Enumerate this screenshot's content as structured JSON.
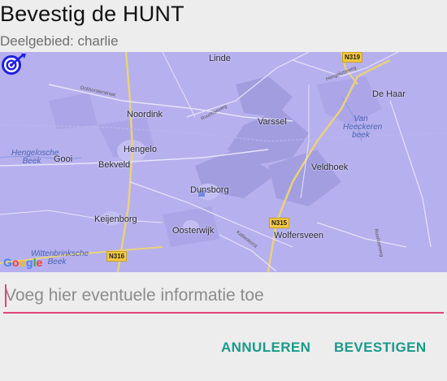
{
  "dialog": {
    "title": "Bevestig de HUNT",
    "subtitle": "Deelgebied: charlie"
  },
  "map": {
    "places": [
      "Linde",
      "De Haar",
      "Noordink",
      "Varssel",
      "Van Heeckeren beek",
      "Hengelo",
      "Hengelosche Beek",
      "Gooi",
      "Bekveld",
      "Veldhoek",
      "Dunsborg",
      "Keijenborg",
      "Oosterwijk",
      "Wolfersveen",
      "Wittenbrinksche Beek"
    ],
    "roads": [
      "N319",
      "N315",
      "N316"
    ],
    "road_labels": [
      "Ockhorsterstraat",
      "Hengeloseweg",
      "Ruurloseweg",
      "Kattenkorst",
      "Ruurloseweg"
    ],
    "attribution": "Google",
    "marker": "target-icon",
    "colors": {
      "overlay": "#b6b0ee",
      "water": "#4a64b0",
      "shield": "#f5c842"
    }
  },
  "input": {
    "value": "",
    "placeholder": "Voeg hier eventuele informatie toe"
  },
  "buttons": {
    "cancel": "ANNULEREN",
    "confirm": "BEVESTIGEN"
  },
  "colors": {
    "accent": "#e0467a",
    "button": "#1a9a8a",
    "background": "#ededed"
  }
}
